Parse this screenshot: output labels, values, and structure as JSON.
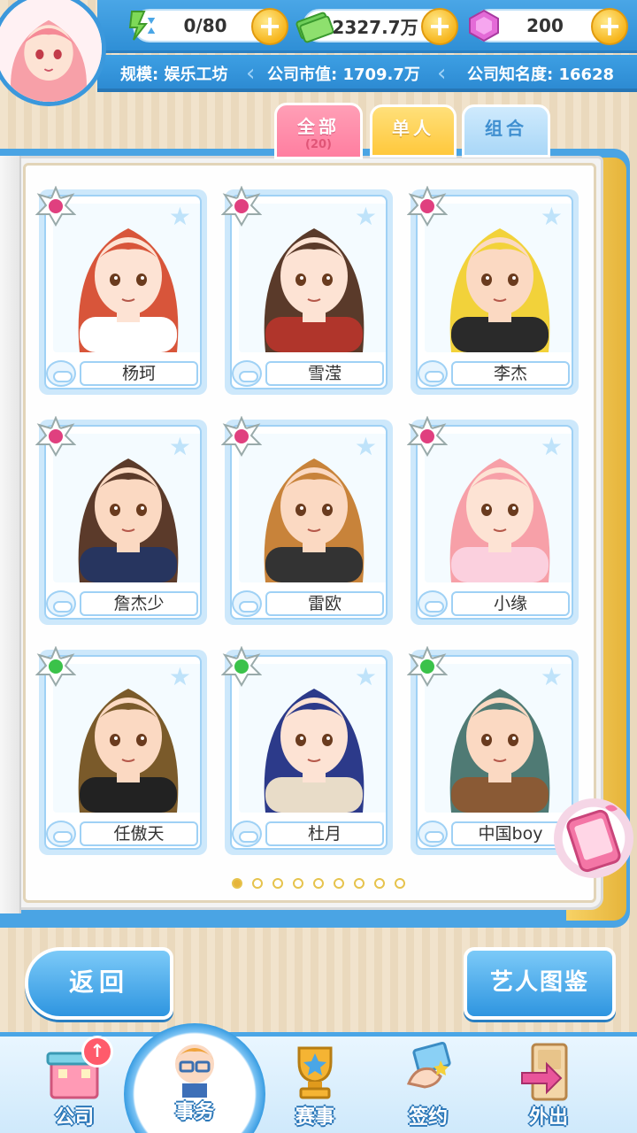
{
  "header": {
    "resources": [
      {
        "name": "energy",
        "icon": "hourglass-icon",
        "value": "0/80"
      },
      {
        "name": "money",
        "icon": "cash-icon",
        "value": "2327.7万"
      },
      {
        "name": "gems",
        "icon": "gem-icon",
        "value": "200"
      }
    ],
    "plus_label": "+",
    "scale": "规模: 娱乐工坊",
    "market_value": "公司市值: 1709.7万",
    "fame": "公司知名度: 16628"
  },
  "tabs": [
    {
      "label": "全部",
      "count": "(20)",
      "active": true
    },
    {
      "label": "单人",
      "active": false
    },
    {
      "label": "组合",
      "active": false
    }
  ],
  "artists": [
    {
      "name": "杨珂",
      "gem": "pink",
      "hair": "#d8553a",
      "skin": "#fde3d4",
      "cloth": "#ffffff"
    },
    {
      "name": "雪滢",
      "gem": "pink",
      "hair": "#5a3a2a",
      "skin": "#fde3d4",
      "cloth": "#b0352b"
    },
    {
      "name": "李杰",
      "gem": "pink",
      "hair": "#f2d23a",
      "skin": "#fbd9c2",
      "cloth": "#2a2a2a"
    },
    {
      "name": "詹杰少",
      "gem": "pink",
      "hair": "#5b3a2a",
      "skin": "#fbd9c2",
      "cloth": "#27355f"
    },
    {
      "name": "雷欧",
      "gem": "pink",
      "hair": "#c8833a",
      "skin": "#fbd9c2",
      "cloth": "#333333"
    },
    {
      "name": "小缘",
      "gem": "pink",
      "hair": "#f7a0a8",
      "skin": "#fde3d4",
      "cloth": "#fbd0de"
    },
    {
      "name": "任傲天",
      "gem": "green",
      "hair": "#7a5a2a",
      "skin": "#fbd9c2",
      "cloth": "#222222"
    },
    {
      "name": "杜月",
      "gem": "green",
      "hair": "#2c3a8a",
      "skin": "#fde3d4",
      "cloth": "#e8dcc8"
    },
    {
      "name": "中国boy",
      "gem": "green",
      "hair": "#4f7a74",
      "skin": "#fbd9c2",
      "cloth": "#8a5a35"
    }
  ],
  "pagination": {
    "total": 9,
    "current": 1
  },
  "buttons": {
    "back": "返回",
    "atlas": "艺人图鉴"
  },
  "nav": [
    {
      "label": "公司",
      "icon": "building-icon"
    },
    {
      "label": "事务",
      "icon": "manager-icon",
      "active": true
    },
    {
      "label": "赛事",
      "icon": "trophy-icon"
    },
    {
      "label": "签约",
      "icon": "handshake-icon"
    },
    {
      "label": "外出",
      "icon": "door-icon"
    }
  ],
  "badge": "↑",
  "colors": {
    "accent": "#3d9fe3",
    "tab_all": "#ff7ea0",
    "tab_single": "#ffc83c",
    "tab_group": "#a9d7f7",
    "gold": "#e6b43a"
  }
}
